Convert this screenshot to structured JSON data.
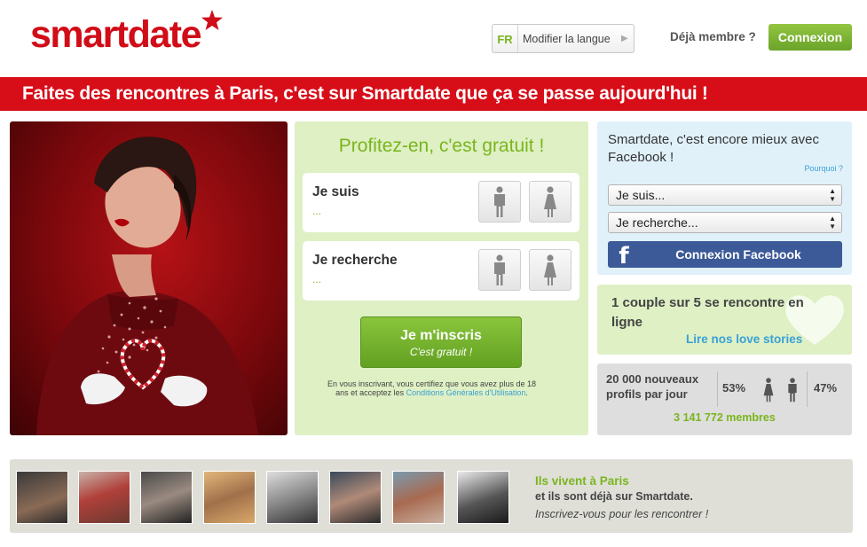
{
  "header": {
    "logo_text": "smartdate",
    "lang_code": "FR",
    "lang_label": "Modifier la langue",
    "member_text": "Déjà membre ?",
    "login_label": "Connexion"
  },
  "banner": {
    "text": "Faites des rencontres à Paris, c'est sur Smartdate que ça se passe aujourd'hui !"
  },
  "signup": {
    "title": "Profitez-en, c'est gratuit !",
    "i_am": {
      "label": "Je suis",
      "value": "..."
    },
    "looking_for": {
      "label": "Je recherche",
      "value": "..."
    },
    "join_label": "Je m'inscris",
    "join_sub": "C'est gratuit !",
    "legal_pre": "En vous inscrivant, vous certifiez que vous avez plus de 18 ans et acceptez les ",
    "legal_link": "Conditions Générales d'Utilisation",
    "legal_post": "."
  },
  "facebook": {
    "title": "Smartdate, c'est encore mieux avec Facebook !",
    "why": "Pourquoi ?",
    "select_i_am": "Je suis...",
    "select_looking": "Je recherche...",
    "button": "Connexion Facebook"
  },
  "couple": {
    "text": "1 couple sur 5 se rencontre en ligne",
    "link": "Lire nos love stories"
  },
  "stats": {
    "new_profiles": "20 000 nouveaux profils par jour",
    "male_pct": "53%",
    "female_pct": "47%",
    "members": "3 141 772 membres"
  },
  "strip": {
    "line1": "Ils vivent à Paris",
    "line2": "et ils sont déjà sur Smartdate.",
    "line3": "Inscrivez-vous pour les rencontrer !"
  },
  "colors": {
    "brand_red": "#d70d18",
    "green": "#7ab51d",
    "blue_link": "#3aa0d6",
    "facebook": "#3d5a98"
  }
}
